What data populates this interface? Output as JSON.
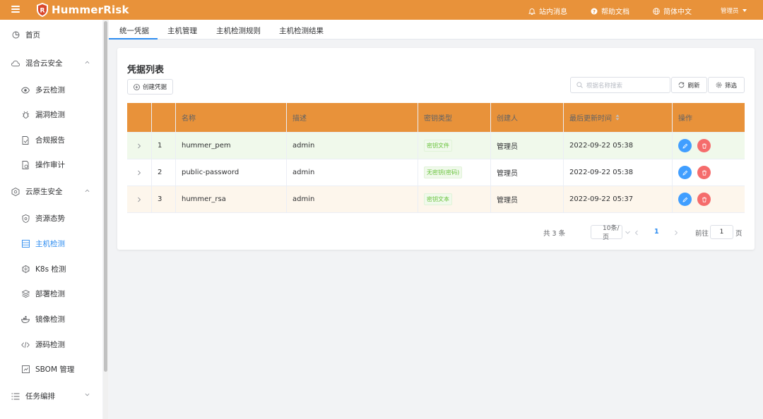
{
  "app": {
    "brand": "HummerRisk",
    "brand_color": "#e8923a"
  },
  "header": {
    "messages_label": "站内消息",
    "help_label": "帮助文档",
    "language_label": "简体中文",
    "user_label": "管理员"
  },
  "sidebar": {
    "items": [
      {
        "label": "首页",
        "icon": "dashboard-icon"
      },
      {
        "label": "混合云安全",
        "icon": "cloud-icon",
        "expanded": true
      },
      {
        "label": "多云检测",
        "icon": "eye-icon"
      },
      {
        "label": "漏洞检测",
        "icon": "bug-icon"
      },
      {
        "label": "合规报告",
        "icon": "report-icon"
      },
      {
        "label": "操作审计",
        "icon": "audit-icon"
      },
      {
        "label": "云原生安全",
        "icon": "cloud-native-icon",
        "expanded": true
      },
      {
        "label": "资源态势",
        "icon": "shield-icon"
      },
      {
        "label": "主机检测",
        "icon": "server-icon",
        "active": true
      },
      {
        "label": "K8s 检测",
        "icon": "k8s-icon"
      },
      {
        "label": "部署检测",
        "icon": "deploy-icon"
      },
      {
        "label": "镜像检测",
        "icon": "image-icon"
      },
      {
        "label": "源码检测",
        "icon": "code-icon"
      },
      {
        "label": "SBOM 管理",
        "icon": "sbom-icon"
      },
      {
        "label": "任务编排",
        "icon": "list-icon",
        "expanded": false
      }
    ],
    "active_color": "#2d8cf0"
  },
  "tabs": [
    {
      "label": "统一凭据",
      "active": true
    },
    {
      "label": "主机管理"
    },
    {
      "label": "主机检测规则"
    },
    {
      "label": "主机检测结果"
    }
  ],
  "card": {
    "title": "凭据列表",
    "create_label": "创建凭据",
    "search_placeholder": "根据名称搜索",
    "refresh_label": "刷新",
    "filter_label": "筛选"
  },
  "table": {
    "columns": [
      "",
      "",
      "名称",
      "描述",
      "密钥类型",
      "创建人",
      "最后更新时间",
      "操作"
    ],
    "rows": [
      {
        "index": "1",
        "name": "hummer_pem",
        "desc": "admin",
        "key_type": "密钥文件",
        "creator": "管理员",
        "updated": "2022-09-22 05:38",
        "highlight": "#f0f9eb"
      },
      {
        "index": "2",
        "name": "public-password",
        "desc": "admin",
        "key_type": "无密钥(密码)",
        "creator": "管理员",
        "updated": "2022-09-22 05:38",
        "highlight": "#ffffff"
      },
      {
        "index": "3",
        "name": "hummer_rsa",
        "desc": "admin",
        "key_type": "密钥文本",
        "creator": "管理员",
        "updated": "2022-09-22 05:37",
        "highlight": "#fdf6ec"
      }
    ]
  },
  "pagination": {
    "total_label": "共 3 条",
    "page_size_label": "10条/页",
    "current_page": "1",
    "goto_label": "前往",
    "goto_value": "1",
    "page_suffix": "页"
  }
}
